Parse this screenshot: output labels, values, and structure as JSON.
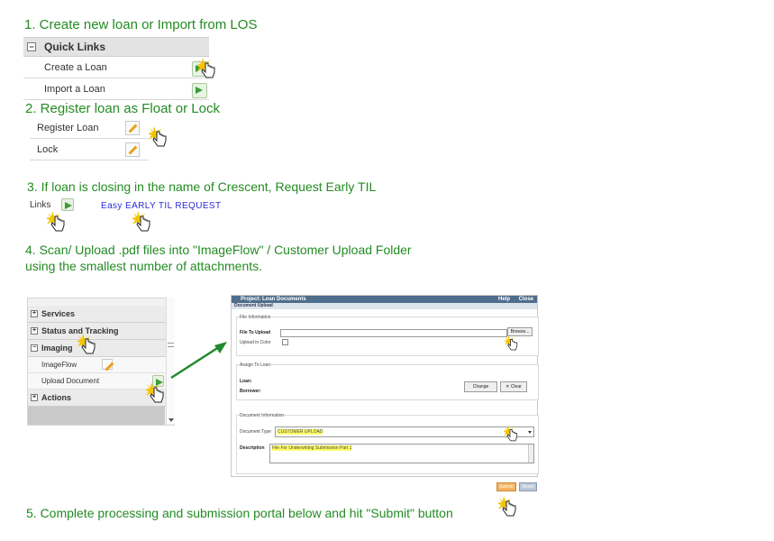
{
  "steps": {
    "s1": "1. Create new loan or Import from LOS",
    "s2": "2.  Register loan as Float or Lock",
    "s3": "3. If loan is closing in the name of Crescent, Request Early TIL",
    "s4a": "4. Scan/ Upload .pdf files into \"ImageFlow\" / Customer Upload Folder",
    "s4b": "using the smallest number of attachments.",
    "s5": "5. Complete processing and submission portal below and hit \"Submit\" button"
  },
  "quick_links": {
    "title": "Quick Links",
    "toggle": "−",
    "items": [
      "Create a Loan",
      "Import a Loan"
    ]
  },
  "register": {
    "items": [
      "Register Loan",
      "Lock"
    ]
  },
  "til": {
    "links_label": "Links",
    "request_link": "Easy EARLY TIL REQUEST"
  },
  "nav": {
    "items": [
      {
        "label": "Services",
        "toggle": "+"
      },
      {
        "label": "Status and Tracking",
        "toggle": "+"
      },
      {
        "label": "Imaging",
        "toggle": "−"
      },
      {
        "label": "Actions",
        "toggle": "+"
      }
    ],
    "sub_items": [
      "ImageFlow",
      "Upload Document"
    ]
  },
  "loan_documents": {
    "title": "Project: Loan Documents",
    "help": "Help",
    "close": "Close",
    "section": "Document Upload",
    "file_info_legend": "File Information",
    "file_to_upload_label": "File To Upload",
    "browse_button": "Browse...",
    "upload_color_label": "Upload in Color",
    "assign_legend": "Assign To Loan",
    "loan_label": "Loan:",
    "borrower_label": "Borrower:",
    "change_button": "Change",
    "clear_button": "Clear",
    "doc_info_legend": "Document Information",
    "doc_type_label": "Document Type",
    "doc_type_value": "CUSTOMER UPLOAD",
    "description_label": "Description",
    "description_value": "File For Underwriting Submission Part 1",
    "submit_button": "Submit",
    "reset_button": "Reset"
  },
  "colors": {
    "step_text": "#238b23",
    "til_link": "#2a2ad6",
    "highlight": "#ffff66",
    "submit_button": "#f3b35e"
  }
}
